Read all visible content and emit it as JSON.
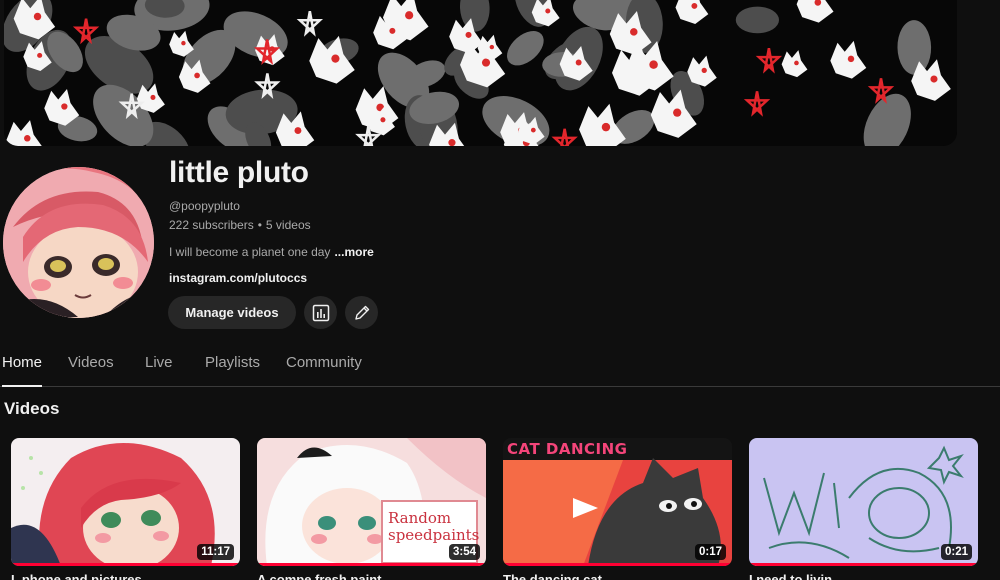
{
  "channel": {
    "name": "little pluto",
    "handle": "@poopypluto",
    "subscribers": "222 subscribers",
    "separator": "•",
    "video_count": "5 videos",
    "description": "I will become a planet one day",
    "more_label": "...more",
    "link": "instagram.com/plutoccs"
  },
  "actions": {
    "manage_label": "Manage videos",
    "analytics_icon": "analytics-icon",
    "edit_icon": "pencil-icon"
  },
  "tabs": [
    {
      "label": "Home",
      "active": true
    },
    {
      "label": "Videos",
      "active": false
    },
    {
      "label": "Live",
      "active": false
    },
    {
      "label": "Playlists",
      "active": false
    },
    {
      "label": "Community",
      "active": false
    }
  ],
  "section": {
    "title": "Videos"
  },
  "videos": [
    {
      "duration": "11:17",
      "title": "I, phone and pictures",
      "progress": 1.0,
      "thumb_text": ""
    },
    {
      "duration": "3:54",
      "title": "A compe fresh paint",
      "progress": 1.0,
      "thumb_text": "Random speedpaints"
    },
    {
      "duration": "0:17",
      "title": "The dancing cat",
      "progress": 1.0,
      "thumb_text": "CAT DANCING"
    },
    {
      "duration": "0:21",
      "title": "I need to livin",
      "progress": 1.0,
      "thumb_text": ""
    }
  ],
  "colors": {
    "background": "#0f0f0f",
    "surface": "#272727",
    "text_primary": "#f1f1f1",
    "text_secondary": "#aaaaaa",
    "progress_red": "#ff0033"
  }
}
